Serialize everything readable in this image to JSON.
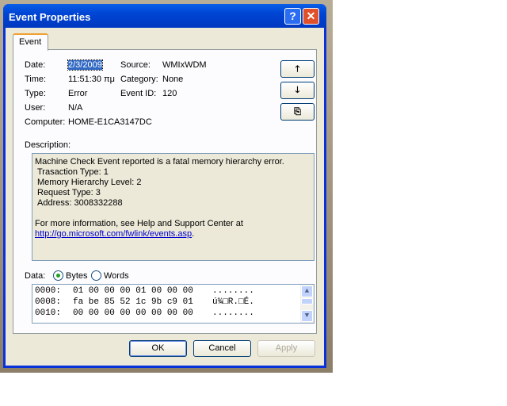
{
  "window": {
    "title": "Event Properties",
    "help": "?",
    "close": "✕"
  },
  "tab": "Event",
  "fields": {
    "date_label": "Date:",
    "date": "2/3/2009",
    "time_label": "Time:",
    "time": "11:51:30 πμ",
    "type_label": "Type:",
    "type": "Error",
    "user_label": "User:",
    "user": "N/A",
    "computer_label": "Computer:",
    "computer": "HOME-E1CA3147DC",
    "source_label": "Source:",
    "source": "WMIxWDM",
    "category_label": "Category:",
    "category": "None",
    "eventid_label": "Event ID:",
    "eventid": "120"
  },
  "nav": {
    "up": "🡑",
    "down": "🡓",
    "copy": "⎘"
  },
  "description": {
    "label": "Description:",
    "lines": [
      "Machine Check Event reported is a fatal memory hierarchy error.",
      "Trasaction Type: 1",
      "Memory Hierarchy Level: 2",
      "Request Type: 3",
      "Address: 3008332288",
      "",
      "For more information, see Help and Support Center at"
    ],
    "link": "http://go.microsoft.com/fwlink/events.asp",
    "link_suffix": "."
  },
  "data": {
    "label": "Data:",
    "bytes": "Bytes",
    "words": "Words",
    "selected": "Bytes",
    "rows": [
      {
        "offset": "0000:",
        "hex": "01 00 00 00 01 00 00 00",
        "ascii": "........"
      },
      {
        "offset": "0008:",
        "hex": "fa be 85 52 1c 9b c9 01",
        "ascii": "ú¾□R.□É."
      },
      {
        "offset": "0010:",
        "hex": "00 00 00 00 00 00 00 00",
        "ascii": "........"
      }
    ]
  },
  "buttons": {
    "ok": "OK",
    "cancel": "Cancel",
    "apply": "Apply"
  }
}
